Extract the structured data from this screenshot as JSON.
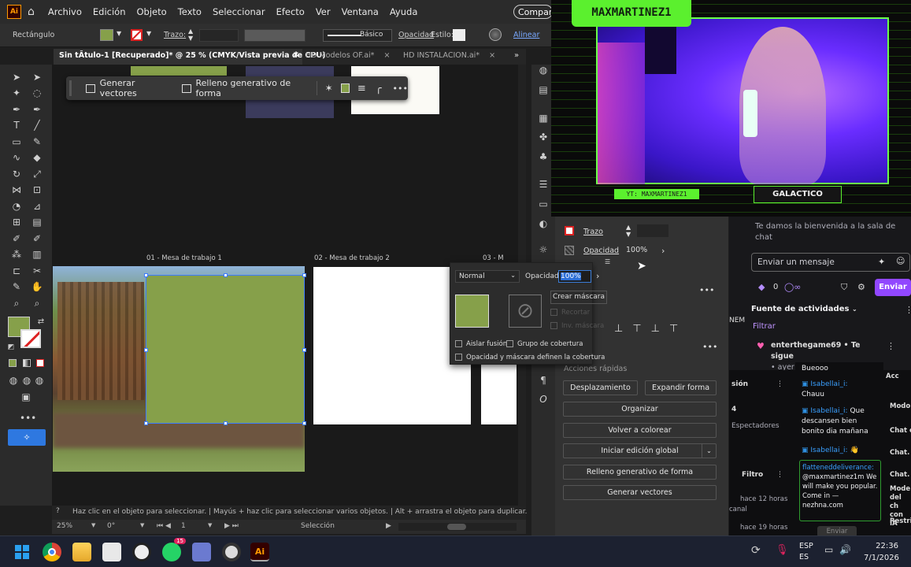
{
  "menubar": {
    "app_logo": "Ai",
    "items": [
      "Archivo",
      "Edición",
      "Objeto",
      "Texto",
      "Seleccionar",
      "Efecto",
      "Ver",
      "Ventana",
      "Ayuda"
    ],
    "share": "Compart"
  },
  "control": {
    "shape": "Rectángulo",
    "stroke_label": "Trazo:",
    "brush": "Básico",
    "opacity": "Opacidad",
    "style": "Estilo:",
    "align": "Alinear",
    "fill_color": "#86a04a"
  },
  "tabs": [
    {
      "label": "Sin tÃtulo-1 [Recuperado]* @ 25 % (CMYK/Vista previa de CPU)"
    },
    {
      "label": "HD Modelos OF.ai*"
    },
    {
      "label": "HD INSTALACION.ai*"
    }
  ],
  "contextbar": {
    "generate": "Generar vectores",
    "fill": "Relleno generativo de forma"
  },
  "artboards": {
    "one": "01 - Mesa de trabajo 1",
    "two": "02 - Mesa de trabajo 2",
    "three": "03 - M"
  },
  "transparency": {
    "mode": "Normal",
    "opacity_label": "Opacidad:",
    "opacity_value": "100%",
    "make_mask": "Crear máscara",
    "clip": "Recortar",
    "invert": "Inv. máscara",
    "isolate": "Aislar fusión",
    "knockout": "Grupo de cobertura",
    "opacity_mask": "Opacidad y máscara definen la cobertura"
  },
  "properties": {
    "stroke": "Trazo",
    "opacity": "Opacidad",
    "opacity_value": "100%",
    "quick_actions": "Acciones rápidas",
    "buttons": [
      "Desplazamiento",
      "Expandir forma",
      "Organizar",
      "Volver a colorear",
      "Iniciar edición global",
      "Relleno generativo de forma",
      "Generar vectores"
    ]
  },
  "status": {
    "hint": "Haz clic en el objeto para seleccionar.  |  Mayús + haz clic para seleccionar varios objetos.  |  Alt + arrastra el objeto para duplicar.",
    "zoom": "25%",
    "rotation": "0°",
    "artboard_num": "1",
    "mode": "Selección"
  },
  "stream": {
    "title": "MAXMARTINEZ1",
    "yt": "YT: MAXMARTINEZ1",
    "tag": "GALACTICO"
  },
  "chat": {
    "welcome": "Te damos la bienvenida a la sala de chat",
    "placeholder": "Enviar un mensaje",
    "points": "0",
    "send": "Enviar",
    "feed": "Fuente de actividades",
    "filter": "Filtrar",
    "follow_user": "enterthegame69",
    "follow_text": "• Te sigue",
    "follow_time": "• ayer",
    "send2": "Enviar"
  },
  "chat_messages": [
    {
      "user": "",
      "text": "Bueooo"
    },
    {
      "user": "Isabellai_i:",
      "text": "Chauu"
    },
    {
      "user": "Isabellai_i:",
      "text": "Que descansen bien bonito dia mañana"
    },
    {
      "user": "Isabellai_i:",
      "text": "👋"
    },
    {
      "user": "flatteneddeliverance:",
      "text": "@maxmartinez1m We will make you popular. Come in — nezhna.com"
    }
  ],
  "chat_left": [
    "NEM",
    "sión",
    "4",
    "Espectadores",
    "Filtro",
    "hace 12 horas",
    "canal",
    "hace 19 horas"
  ],
  "chat_right": [
    "Acc",
    "Modo",
    "Chat c",
    "Chat.",
    "Chat.",
    "Mode del ch con IA",
    "Restri"
  ],
  "taskbar": {
    "lang1": "ESP",
    "lang2": "ES",
    "time": "22:36",
    "date": "7/1/2026",
    "badge": "15"
  }
}
